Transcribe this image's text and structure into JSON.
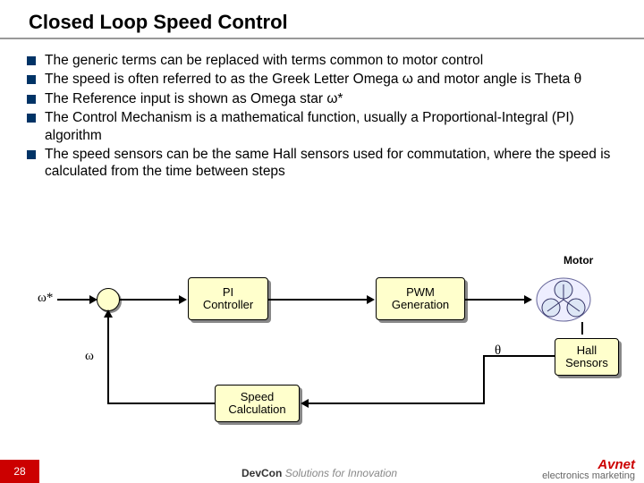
{
  "title": "Closed Loop Speed Control",
  "bullets": [
    "The generic terms can be replaced with terms common to motor control",
    "The speed is often referred to as the Greek Letter Omega ω and motor angle is Theta θ",
    "The Reference input is shown as Omega star ω*",
    "The Control Mechanism is a mathematical function, usually a Proportional-Integral (PI) algorithm",
    "The speed sensors can be the same Hall sensors used for commutation, where the speed is calculated from the time between steps"
  ],
  "diagram": {
    "input_label": "ω*",
    "feedback_label": "ω",
    "angle_label": "θ",
    "motor_label": "Motor",
    "blocks": {
      "controller": "PI\nController",
      "pwm": "PWM\nGeneration",
      "hall": "Hall\nSensors",
      "speed": "Speed\nCalculation"
    }
  },
  "footer": {
    "page": "28",
    "center_brand": "DevCon",
    "center_tag": "Solutions for Innovation",
    "right_brand": "Avnet",
    "right_tag": "electronics marketing"
  }
}
